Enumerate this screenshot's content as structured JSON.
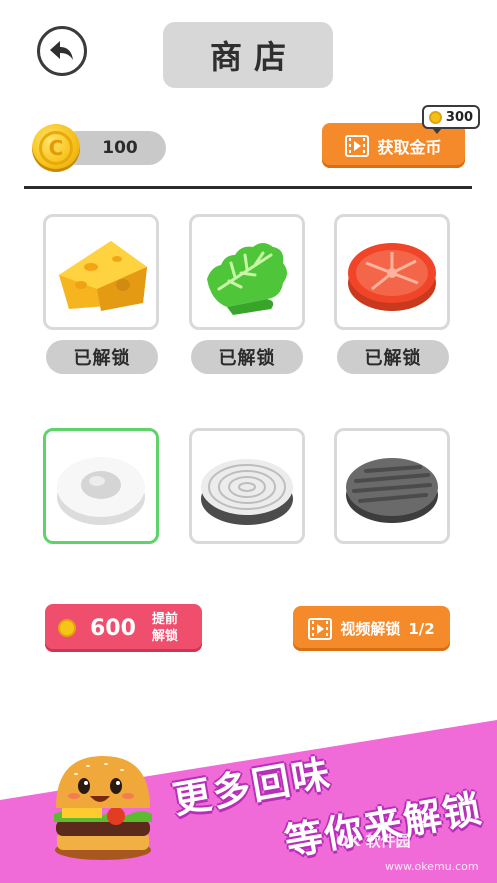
{
  "header": {
    "back_icon": "back-arrow-icon",
    "title": "商店"
  },
  "wallet": {
    "coin_icon": "gold-coin-icon",
    "balance": "100"
  },
  "get_coins": {
    "label": "获取金币",
    "icon": "video-film-icon",
    "reward_amount": "300"
  },
  "items": [
    {
      "name": "cheese",
      "icon": "cheese-icon",
      "status": "已解锁",
      "selected": false
    },
    {
      "name": "lettuce",
      "icon": "lettuce-icon",
      "status": "已解锁",
      "selected": false
    },
    {
      "name": "tomato",
      "icon": "tomato-slice-icon",
      "status": "已解锁",
      "selected": false
    },
    {
      "name": "egg",
      "icon": "fried-egg-icon",
      "selected": true
    },
    {
      "name": "onion",
      "icon": "onion-slice-icon",
      "selected": false
    },
    {
      "name": "patty",
      "icon": "burger-patty-icon",
      "selected": false
    }
  ],
  "buy_early": {
    "price": "600",
    "label_line1": "提前",
    "label_line2": "解锁"
  },
  "video_unlock": {
    "label": "视频解锁",
    "progress": "1/2"
  },
  "promo": {
    "line1": "更多回味",
    "line2": "等你来解锁",
    "watermark": "OK 软件园",
    "watermark_url": "www.okemu.com"
  },
  "colors": {
    "accent_orange": "#f58a2a",
    "accent_pink": "#ef4e6d",
    "selected_green": "#5fd36a",
    "promo_magenta": "#f06ad8"
  }
}
